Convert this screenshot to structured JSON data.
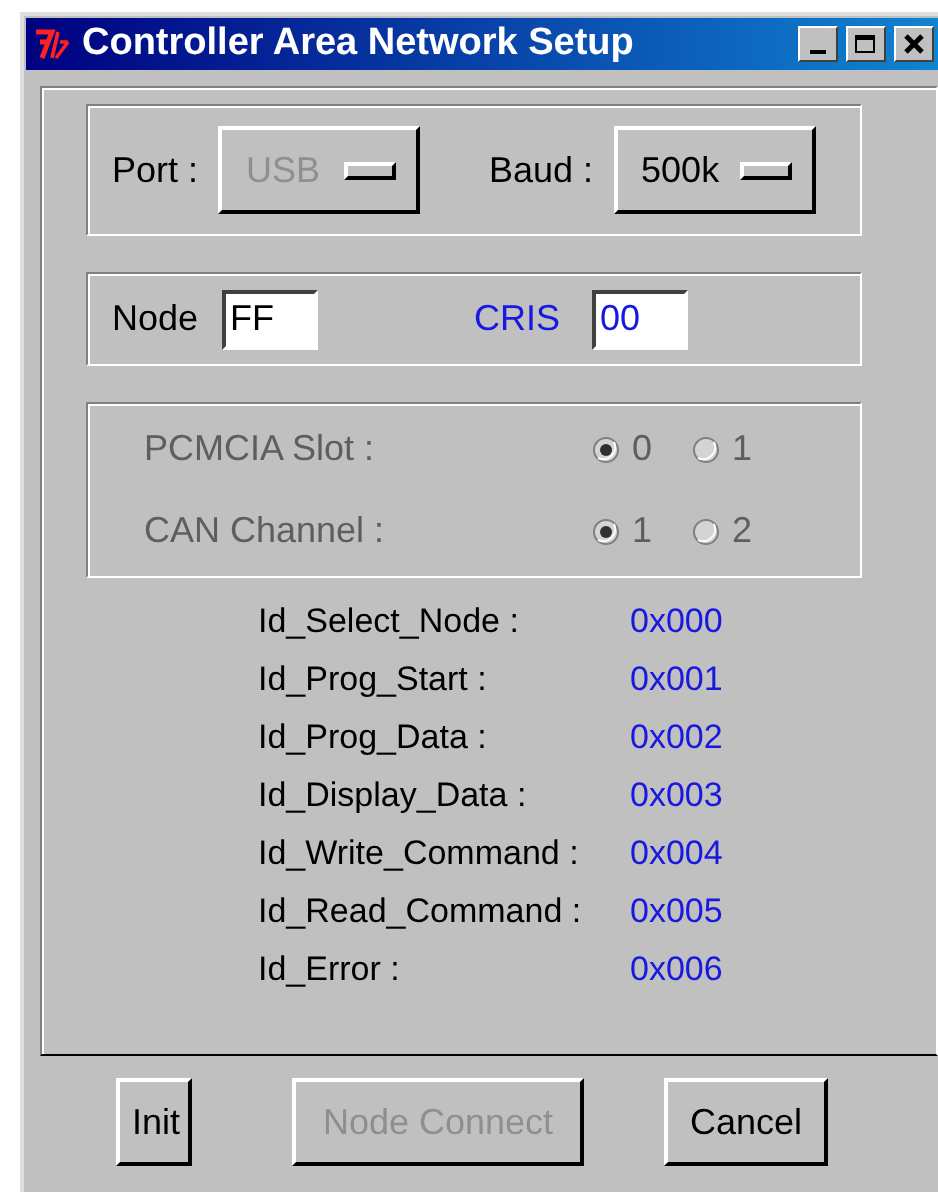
{
  "window": {
    "title": "Controller Area Network Setup"
  },
  "connection": [
    {
      "label": "Port :",
      "value": "USB",
      "disabled": true
    },
    {
      "label": "Baud :",
      "value": "500k",
      "disabled": false
    }
  ],
  "node": {
    "label": "Node",
    "value": "FF"
  },
  "cris": {
    "label": "CRIS",
    "value": "00"
  },
  "slot_group": {
    "disabled": true,
    "rows": [
      {
        "label": "PCMCIA Slot :",
        "options": [
          {
            "label": "0",
            "selected": true
          },
          {
            "label": "1",
            "selected": false
          }
        ]
      },
      {
        "label": "CAN Channel :",
        "options": [
          {
            "label": "1",
            "selected": true
          },
          {
            "label": "2",
            "selected": false
          }
        ]
      }
    ]
  },
  "ids": [
    {
      "name": "Id_Select_Node :",
      "value": "0x000"
    },
    {
      "name": "Id_Prog_Start :",
      "value": "0x001"
    },
    {
      "name": "Id_Prog_Data :",
      "value": "0x002"
    },
    {
      "name": "Id_Display_Data :",
      "value": "0x003"
    },
    {
      "name": "Id_Write_Command :",
      "value": "0x004"
    },
    {
      "name": "Id_Read_Command :",
      "value": "0x005"
    },
    {
      "name": "Id_Error :",
      "value": "0x006"
    }
  ],
  "buttons": [
    {
      "label": "Init",
      "disabled": false
    },
    {
      "label": "Node Connect",
      "disabled": true
    },
    {
      "label": "Cancel",
      "disabled": false
    }
  ]
}
